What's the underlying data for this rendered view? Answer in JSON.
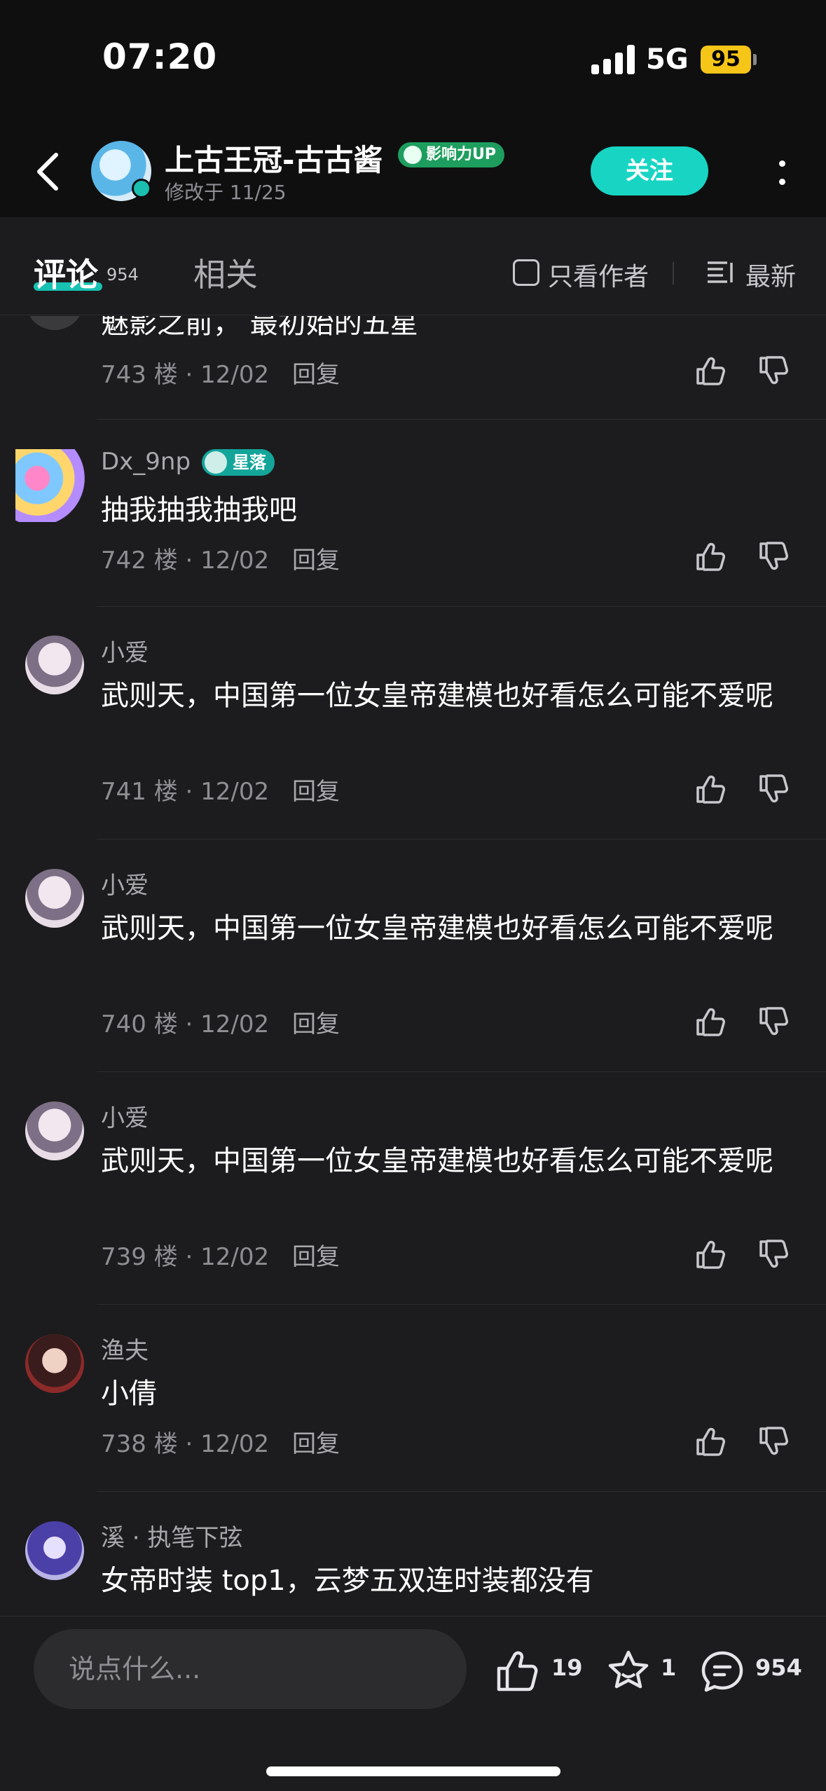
{
  "status": {
    "time": "07:20",
    "network": "5G",
    "battery": "95"
  },
  "header": {
    "title": "上古王冠-古古酱",
    "badge": "影响力UP",
    "subtitle": "修改于 11/25",
    "follow_label": "关注"
  },
  "tabs": {
    "comments_label": "评论",
    "comments_count": "954",
    "related_label": "相关",
    "author_only_label": "只看作者",
    "sort_label": "最新"
  },
  "comments": [
    {
      "text": "魅影之前，   最初始的五星",
      "floor": "743 楼",
      "dot": "·",
      "date": "12/02",
      "reply": "回复"
    },
    {
      "user": "Dx_9np",
      "badge": "星落",
      "text": "抽我抽我抽我吧",
      "floor": "742 楼",
      "dot": "·",
      "date": "12/02",
      "reply": "回复"
    },
    {
      "user": "小爱",
      "text": "武则天，中国第一位女皇帝建模也好看怎么可能不爱呢",
      "floor": "741 楼",
      "dot": "·",
      "date": "12/02",
      "reply": "回复"
    },
    {
      "user": "小爱",
      "text": "武则天，中国第一位女皇帝建模也好看怎么可能不爱呢",
      "floor": "740 楼",
      "dot": "·",
      "date": "12/02",
      "reply": "回复"
    },
    {
      "user": "小爱",
      "text": "武则天，中国第一位女皇帝建模也好看怎么可能不爱呢",
      "floor": "739 楼",
      "dot": "·",
      "date": "12/02",
      "reply": "回复"
    },
    {
      "user": "渔夫",
      "text": "小倩",
      "floor": "738 楼",
      "dot": "·",
      "date": "12/02",
      "reply": "回复"
    },
    {
      "user": "溪 · 执笔下弦",
      "text": "女帝时装 top1，云梦五双连时装都没有"
    }
  ],
  "bottom": {
    "input_placeholder": "说点什么...",
    "like_count": "19",
    "star_count": "1",
    "comment_count": "954"
  },
  "colors": {
    "accent": "#18d5c3",
    "background": "#1c1c1e",
    "header_bg": "#0f0f10",
    "battery": "#f5c518"
  }
}
